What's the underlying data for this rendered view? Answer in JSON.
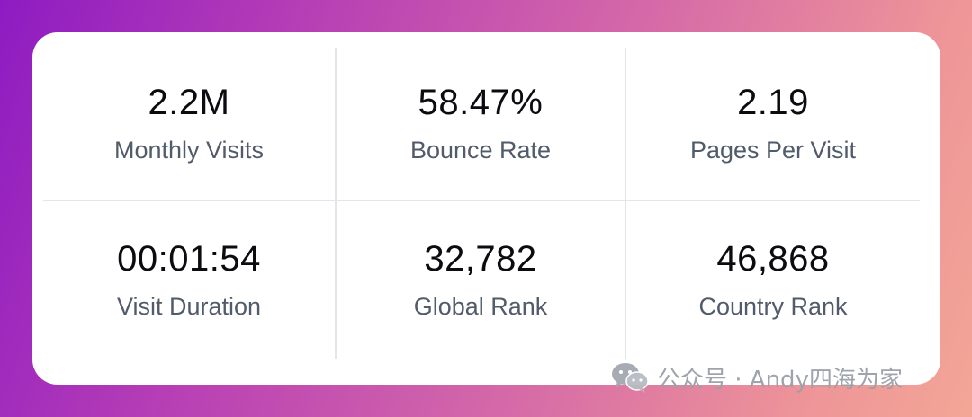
{
  "stats": [
    {
      "value": "2.2M",
      "label": "Monthly Visits"
    },
    {
      "value": "58.47%",
      "label": "Bounce Rate"
    },
    {
      "value": "2.19",
      "label": "Pages Per Visit"
    },
    {
      "value": "00:01:54",
      "label": "Visit Duration"
    },
    {
      "value": "32,782",
      "label": "Global Rank"
    },
    {
      "value": "46,868",
      "label": "Country Rank"
    }
  ],
  "watermark": {
    "text": "公众号 · Andy四海为家",
    "icon": "wechat-icon"
  },
  "colors": {
    "card_bg": "#ffffff",
    "value_text": "#0b0b10",
    "label_text": "#515b6a",
    "divider": "#e2e5ea"
  }
}
